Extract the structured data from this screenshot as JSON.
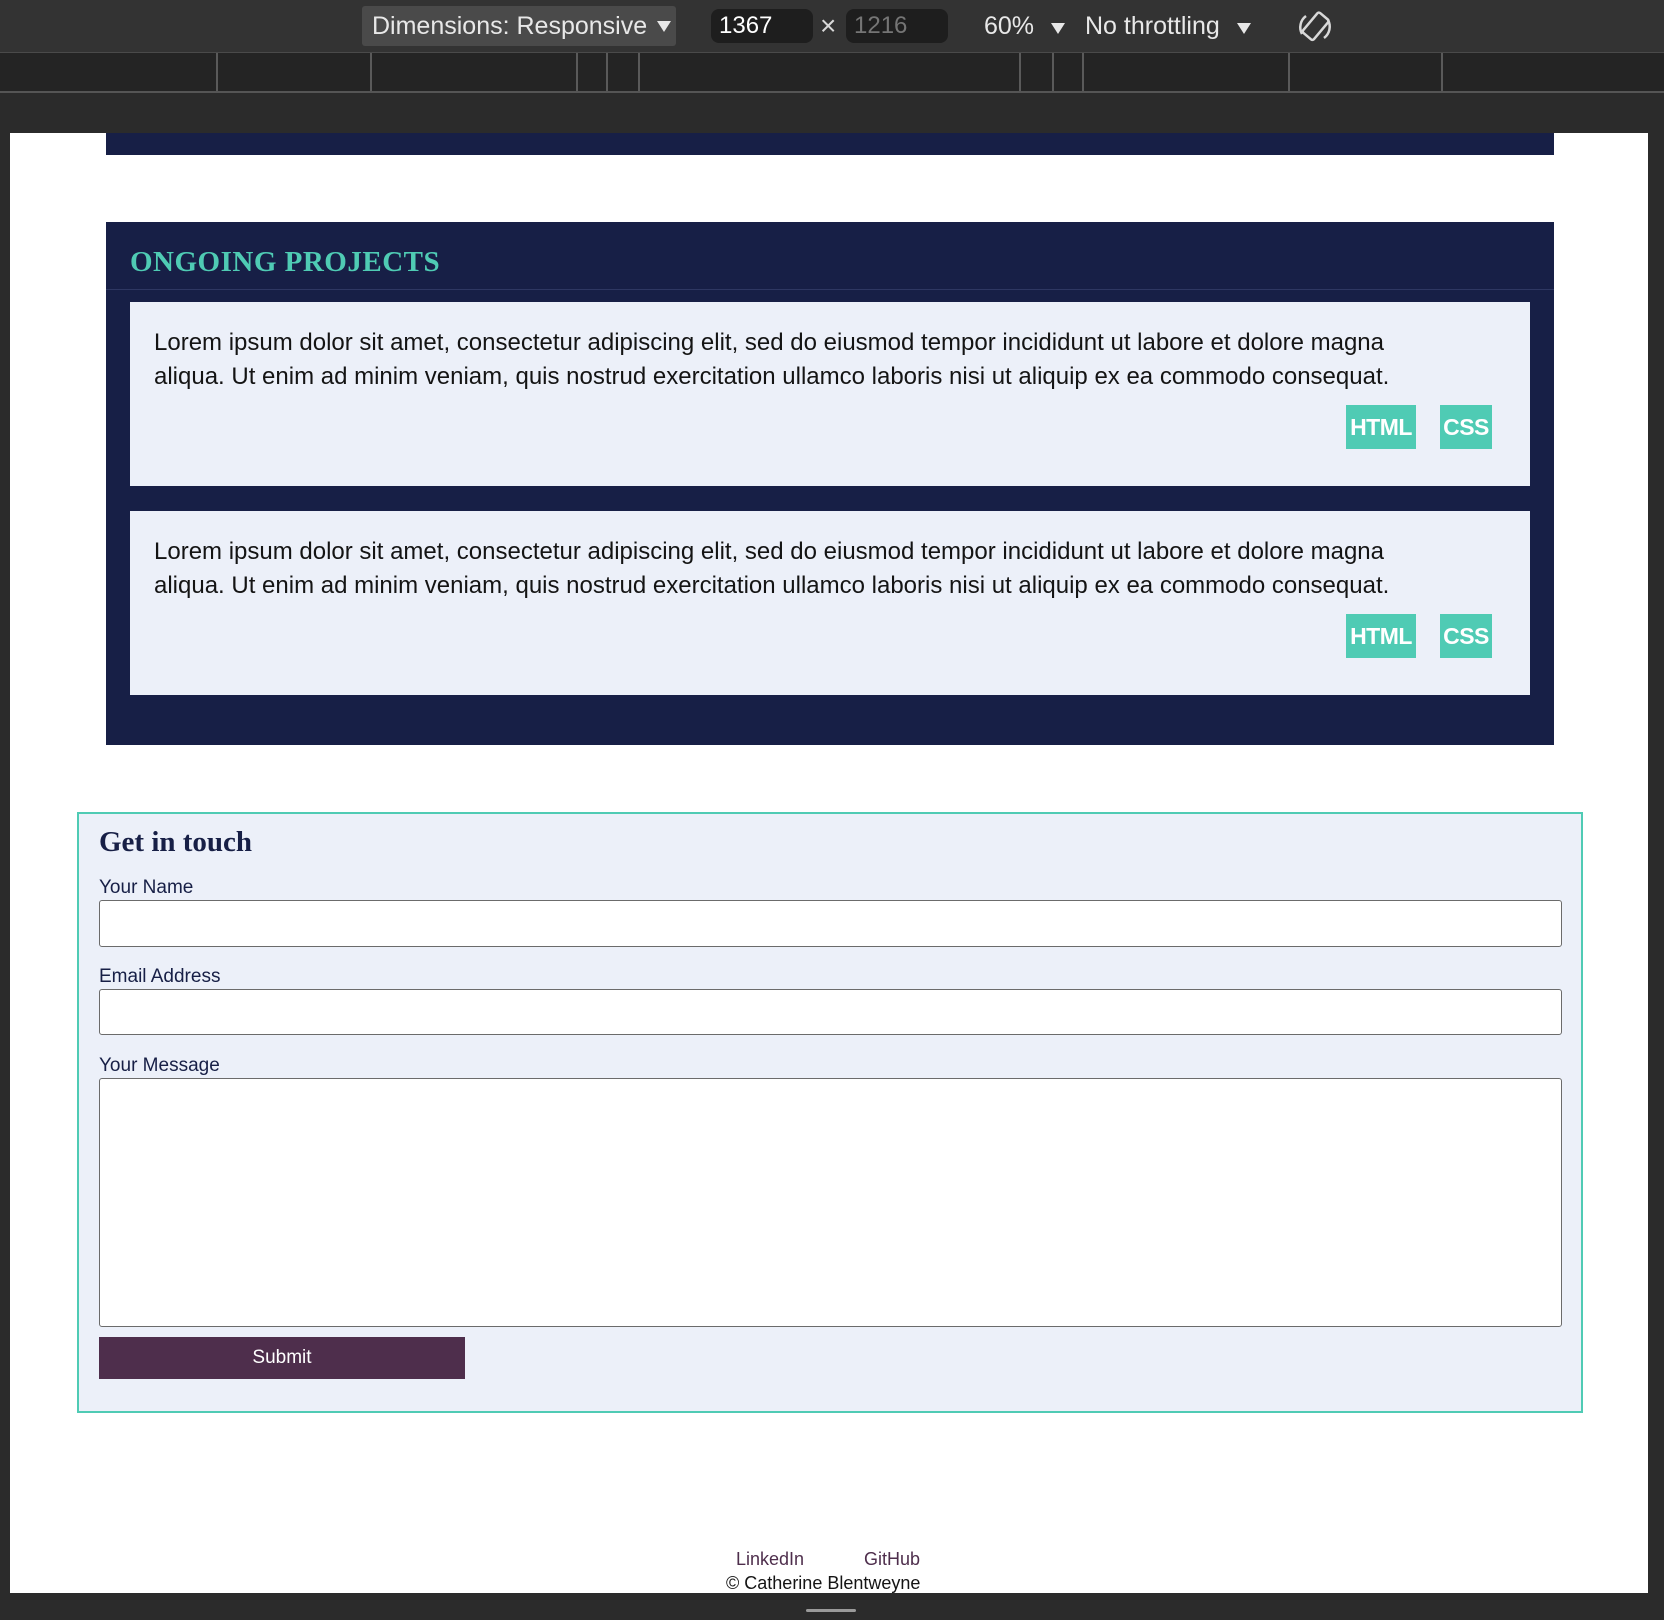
{
  "devtools": {
    "dimensions_label": "Dimensions: Responsive",
    "width_value": "1367",
    "height_value": "1216",
    "times_symbol": "×",
    "zoom_label": "60%",
    "throttling_label": "No throttling"
  },
  "projects": {
    "title": "ONGOING PROJECTS",
    "cards": [
      {
        "text": "Lorem ipsum dolor sit amet, consectetur adipiscing elit, sed do eiusmod tempor incididunt ut labore et dolore magna aliqua. Ut enim ad minim veniam, quis nostrud exercitation ullamco laboris nisi ut aliquip ex ea commodo consequat.",
        "tags": [
          "HTML",
          "CSS"
        ]
      },
      {
        "text": "Lorem ipsum dolor sit amet, consectetur adipiscing elit, sed do eiusmod tempor incididunt ut labore et dolore magna aliqua. Ut enim ad minim veniam, quis nostrud exercitation ullamco laboris nisi ut aliquip ex ea commodo consequat.",
        "tags": [
          "HTML",
          "CSS"
        ]
      }
    ]
  },
  "contact": {
    "title": "Get in touch",
    "name_label": "Your Name",
    "name_value": "",
    "email_label": "Email Address",
    "email_value": "",
    "message_label": "Your Message",
    "message_value": "",
    "submit_label": "Submit"
  },
  "footer": {
    "links": [
      "LinkedIn",
      "GitHub"
    ],
    "copyright_symbol": "©",
    "copyright_name": "Catherine Blentweyne"
  },
  "colors": {
    "navy": "#171f46",
    "teal_accent": "#4fcbb4",
    "card_bg": "#ecf0f9",
    "plum_button": "#4e2e4c"
  },
  "icons": [
    "chevron-down-icon",
    "rotate-device-icon",
    "close-x-icon"
  ]
}
